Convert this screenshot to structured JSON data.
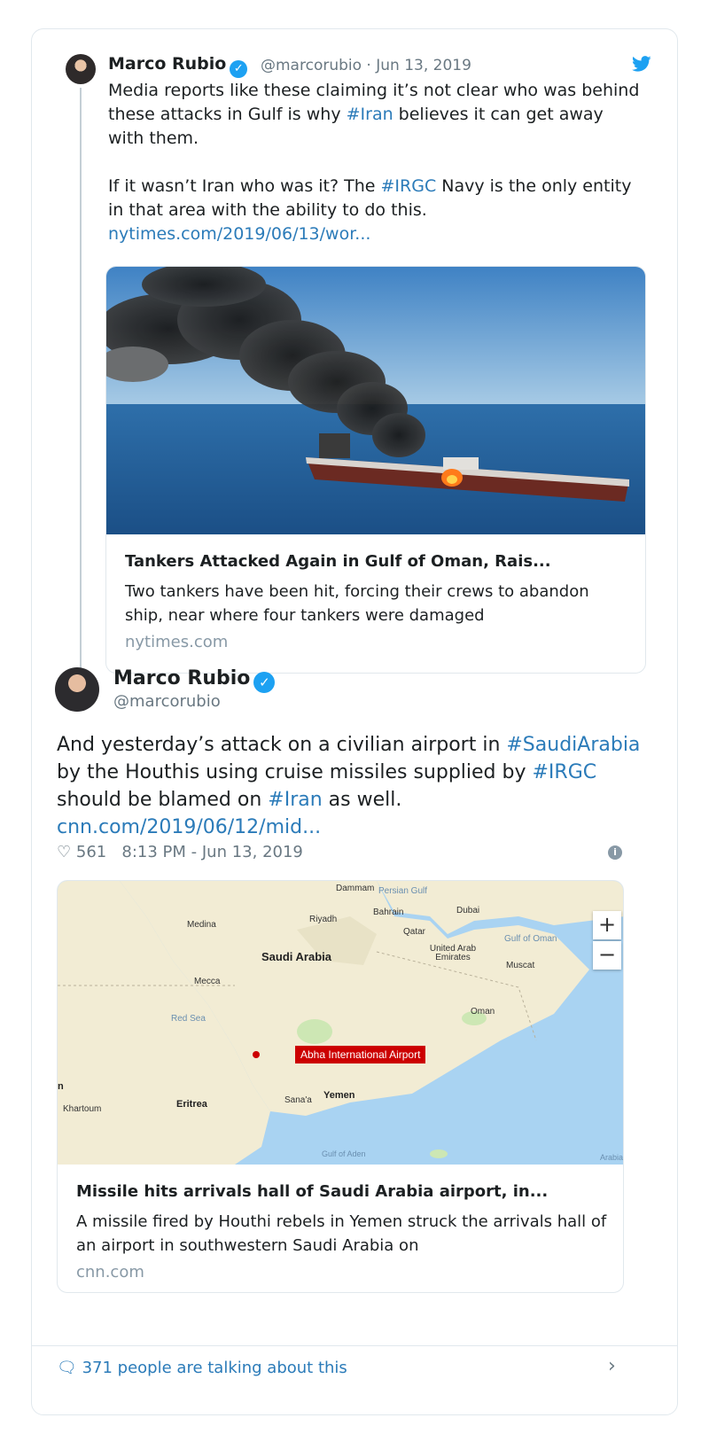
{
  "parent_tweet": {
    "name": "Marco Rubio",
    "handle": "@marcorubio",
    "date": "Jun 13, 2019",
    "text_para1": [
      {
        "t": "Media reports like these claiming it’s not clear who was behind these attacks in Gulf is why ",
        "link": false
      },
      {
        "t": "#Iran",
        "link": true
      },
      {
        "t": " believes it can get away with them.",
        "link": false
      }
    ],
    "text_para2": [
      {
        "t": "If it wasn’t Iran who was it? The ",
        "link": false
      },
      {
        "t": "#IRGC",
        "link": true
      },
      {
        "t": " Navy is the only entity in that area with the ability to do this.",
        "link": false
      }
    ],
    "url": "nytimes.com/2019/06/13/wor...",
    "card": {
      "title": "Tankers Attacked Again in Gulf of Oman, Rais...",
      "description": "Two tankers have been hit, forcing their crews to abandon ship, near where four tankers were damaged",
      "host": "nytimes.com"
    }
  },
  "main_tweet": {
    "name": "Marco Rubio",
    "handle": "@marcorubio",
    "text": [
      {
        "t": "And yesterday’s attack on a civilian airport in ",
        "link": false
      },
      {
        "t": "#SaudiArabia",
        "link": true
      },
      {
        "t": " by the Houthis using cruise missiles supplied by ",
        "link": false
      },
      {
        "t": "#IRGC",
        "link": true
      },
      {
        "t": " should be blamed on ",
        "link": false
      },
      {
        "t": "#Iran",
        "link": true
      },
      {
        "t": " as well. ",
        "link": false
      },
      {
        "t": "cnn.com/2019/06/12/mid...",
        "link": true
      }
    ],
    "likes": "561",
    "timestamp": "8:13 PM - Jun 13, 2019",
    "card": {
      "title": "Missile hits arrivals hall of Saudi Arabia airport, in...",
      "description": "A missile fired by Houthi rebels in Yemen struck the arrivals hall of an airport in southwestern Saudi Arabia on",
      "host": "cnn.com"
    },
    "map_labels": {
      "dammam": "Dammam",
      "persian_gulf": "Persian Gulf",
      "bahrain": "Bahrain",
      "dubai": "Dubai",
      "medina": "Medina",
      "riyadh": "Riyadh",
      "qatar": "Qatar",
      "gulf_of_oman": "Gulf of Oman",
      "saudi_arabia": "Saudi Arabia",
      "uae": "United Arab Emirates",
      "muscat": "Muscat",
      "mecca": "Mecca",
      "oman": "Oman",
      "red_sea": "Red Sea",
      "airport": "Abha International Airport",
      "khartoum": "Khartoum",
      "eritrea": "Eritrea",
      "sanaa": "Sana'a",
      "yemen": "Yemen",
      "gulf_of_aden": "Gulf of Aden",
      "arabia": "Arabia",
      "edge_n": "n"
    }
  },
  "footer": {
    "talking": "371 people are talking about this"
  },
  "colors": {
    "link": "#2b7bb9",
    "verified": "#1da1f2",
    "muted": "#697882"
  }
}
